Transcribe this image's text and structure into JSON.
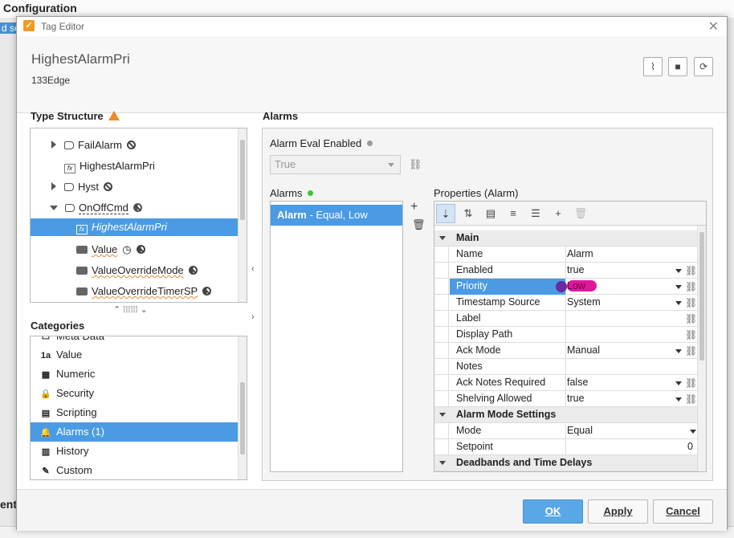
{
  "background": {
    "title": "Configuration",
    "side_text": "d se",
    "bottom_text": "ently"
  },
  "window": {
    "title": "Tag Editor",
    "close_symbol": "✕"
  },
  "header": {
    "tag_name": "HighestAlarmPri",
    "tag_path": "133Edge"
  },
  "type_structure": {
    "title": "Type Structure",
    "items": [
      {
        "label": "FailAlarm",
        "icon": "tag-icon"
      },
      {
        "label": "HighestAlarmPri",
        "icon": "expression-icon"
      },
      {
        "label": "Hyst",
        "icon": "tag-icon"
      },
      {
        "label": "OnOffCmd",
        "icon": "tag-icon"
      },
      {
        "label": "HighestAlarmPri",
        "icon": "expression-icon"
      },
      {
        "label": "Value",
        "icon": "value-icon"
      },
      {
        "label": "ValueOverrideMode",
        "icon": "value-icon"
      },
      {
        "label": "ValueOverrideTimerSP",
        "icon": "value-icon"
      }
    ]
  },
  "categories": {
    "title": "Categories",
    "items": [
      {
        "label": "Meta Data",
        "icon": "tag-icon"
      },
      {
        "label": "Value",
        "icon": "1a"
      },
      {
        "label": "Numeric",
        "icon": "▦"
      },
      {
        "label": "Security",
        "icon": "🔒"
      },
      {
        "label": "Scripting",
        "icon": "▤"
      },
      {
        "label": "Alarms (1)",
        "icon": "🔔"
      },
      {
        "label": "History",
        "icon": "▥"
      },
      {
        "label": "Custom",
        "icon": "✎"
      }
    ]
  },
  "alarms_section": {
    "title": "Alarms",
    "eval_label": "Alarm Eval Enabled",
    "eval_value": "True",
    "alarms_label": "Alarms",
    "alarm_name": "Alarm",
    "alarm_desc": " - Equal, Low",
    "properties_label": "Properties (Alarm)"
  },
  "properties": [
    {
      "type": "cat",
      "name": "Main"
    },
    {
      "type": "row",
      "name": "Name",
      "value": "Alarm"
    },
    {
      "type": "row",
      "name": "Enabled",
      "value": "true"
    },
    {
      "type": "row",
      "name": "Priority",
      "value": "Low"
    },
    {
      "type": "row",
      "name": "Timestamp Source",
      "value": "System"
    },
    {
      "type": "row",
      "name": "Label",
      "value": ""
    },
    {
      "type": "row",
      "name": "Display Path",
      "value": ""
    },
    {
      "type": "row",
      "name": "Ack Mode",
      "value": "Manual"
    },
    {
      "type": "row",
      "name": "Notes",
      "value": ""
    },
    {
      "type": "row",
      "name": "Ack Notes Required",
      "value": "false"
    },
    {
      "type": "row",
      "name": "Shelving Allowed",
      "value": "true"
    },
    {
      "type": "cat",
      "name": "Alarm Mode Settings"
    },
    {
      "type": "row",
      "name": "Mode",
      "value": "Equal"
    },
    {
      "type": "row",
      "name": "Setpoint",
      "value": "0"
    },
    {
      "type": "cat",
      "name": "Deadbands and Time Delays"
    }
  ],
  "footer": {
    "ok": "OK",
    "apply": "Apply",
    "cancel": "Cancel"
  },
  "colors": {
    "accent": "#4a9be3",
    "warning": "#f08a24",
    "status_ok": "#3ec43e",
    "highlight": "#e0179a"
  }
}
